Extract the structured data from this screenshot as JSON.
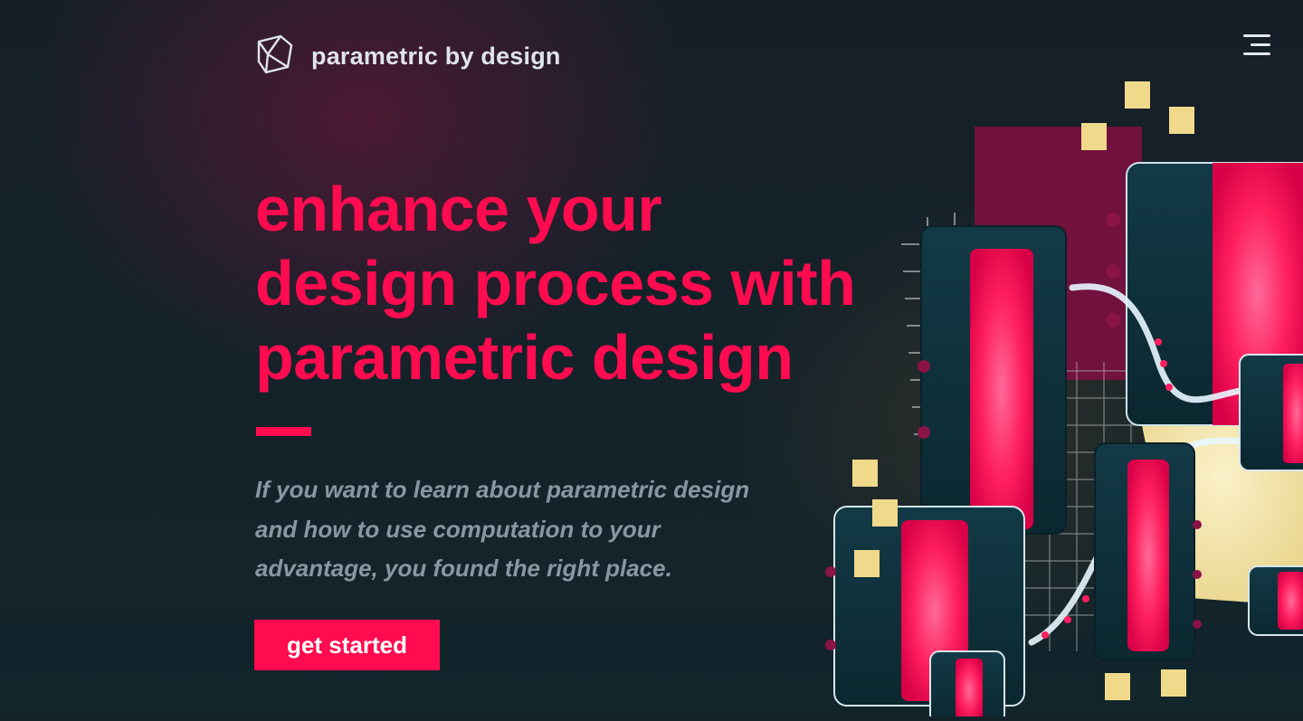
{
  "brand": {
    "name": "parametric by design",
    "logo_icon": "folded-cube-icon"
  },
  "nav": {
    "menu_icon": "hamburger-menu-icon"
  },
  "hero": {
    "title_lines": [
      "enhance your",
      "design process with",
      "parametric design"
    ],
    "subtitle_lines": [
      "If you want to learn about parametric design",
      "and how to use computation to your",
      "advantage, you found the right place."
    ],
    "cta_label": "get started"
  },
  "colors": {
    "accent": "#ff0b4f",
    "background": "#14232a",
    "text_light": "#dfe4ea",
    "text_muted": "#8a97a2",
    "panel_dark": "#0f3440",
    "gold": "#f0d98a"
  }
}
